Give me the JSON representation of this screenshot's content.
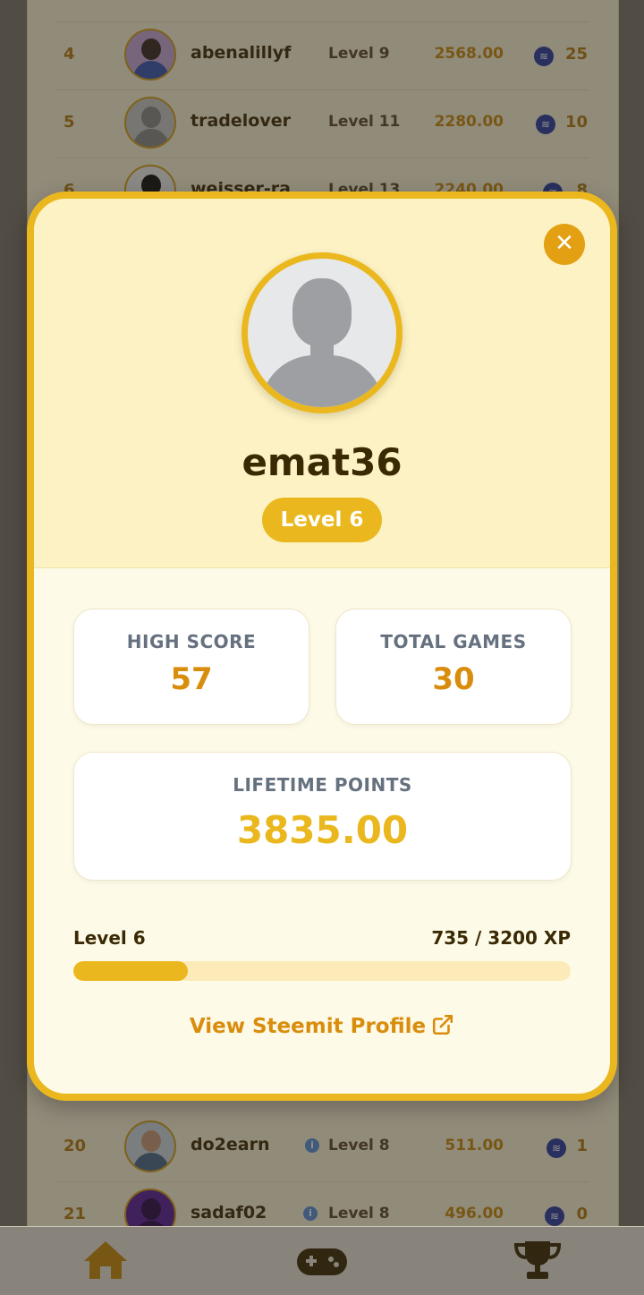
{
  "leaderboard": {
    "rows": [
      {
        "rank": "4",
        "name": "abenalillyf",
        "level": "Level 9",
        "points": "2568.00",
        "reward": "25"
      },
      {
        "rank": "5",
        "name": "tradelover",
        "level": "Level 11",
        "points": "2280.00",
        "reward": "10"
      },
      {
        "rank": "6",
        "name": "weisser-ra",
        "level": "Level 13",
        "points": "2240.00",
        "reward": "8"
      },
      {
        "rank": "20",
        "name": "do2earn",
        "level": "Level 8",
        "points": "511.00",
        "reward": "1"
      },
      {
        "rank": "21",
        "name": "sadaf02",
        "level": "Level 8",
        "points": "496.00",
        "reward": "0"
      }
    ],
    "info_glyph": "i",
    "coin_icon": "steem-coin-icon"
  },
  "modal": {
    "close_glyph": "✕",
    "username": "emat36",
    "level_badge": "Level 6",
    "stats": {
      "high_score_label": "HIGH SCORE",
      "high_score_value": "57",
      "total_games_label": "TOTAL GAMES",
      "total_games_value": "30",
      "lifetime_label": "LIFETIME POINTS",
      "lifetime_value": "3835.00"
    },
    "progress": {
      "level_label": "Level 6",
      "xp_text": "735 / 3200 XP",
      "fraction": 0.2297
    },
    "profile_link": "View Steemit Profile"
  },
  "bottom_nav": {
    "items": [
      "home-icon",
      "gamepad-icon",
      "trophy-icon"
    ]
  },
  "colors": {
    "accent": "#eab81e",
    "accent_dark": "#d98d0c",
    "text_dark": "#3a2a04"
  }
}
